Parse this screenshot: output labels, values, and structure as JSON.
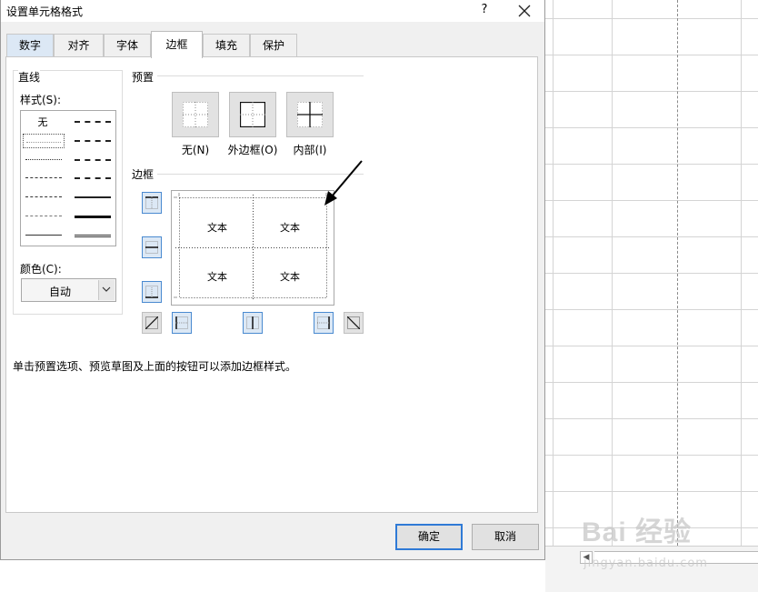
{
  "dialog": {
    "title": "设置单元格格式",
    "help": "?",
    "tabs": [
      "数字",
      "对齐",
      "字体",
      "边框",
      "填充",
      "保护"
    ],
    "active_tab": "边框"
  },
  "line": {
    "group_label": "直线",
    "style_label": "样式(S):",
    "style_none": "无",
    "color_label": "颜色(C):",
    "color_value": "自动"
  },
  "presets": {
    "group_label": "预置",
    "items": [
      {
        "label": "无(N)",
        "icon": "border-none-icon"
      },
      {
        "label": "外边框(O)",
        "icon": "border-outline-icon"
      },
      {
        "label": "内部(I)",
        "icon": "border-inside-icon"
      }
    ]
  },
  "border": {
    "group_label": "边框",
    "preview_cells": [
      "文本",
      "文本",
      "文本",
      "文本"
    ],
    "buttons": [
      "border-top-icon",
      "border-middle-horizontal-icon",
      "border-bottom-icon",
      "border-diagonal-up-icon",
      "border-left-icon",
      "border-middle-vertical-icon",
      "border-right-icon",
      "border-diagonal-down-icon"
    ]
  },
  "hint": "单击预置选项、预览草图及上面的按钮可以添加边框样式。",
  "buttons": {
    "ok": "确定",
    "cancel": "取消"
  },
  "watermark": {
    "logo": "Bai 经验",
    "url": "jingyan.baidu.com"
  },
  "colors": {
    "accent": "#2f7ad6",
    "selected_button": "#dce8f5",
    "panel": "#f0f0f0"
  }
}
